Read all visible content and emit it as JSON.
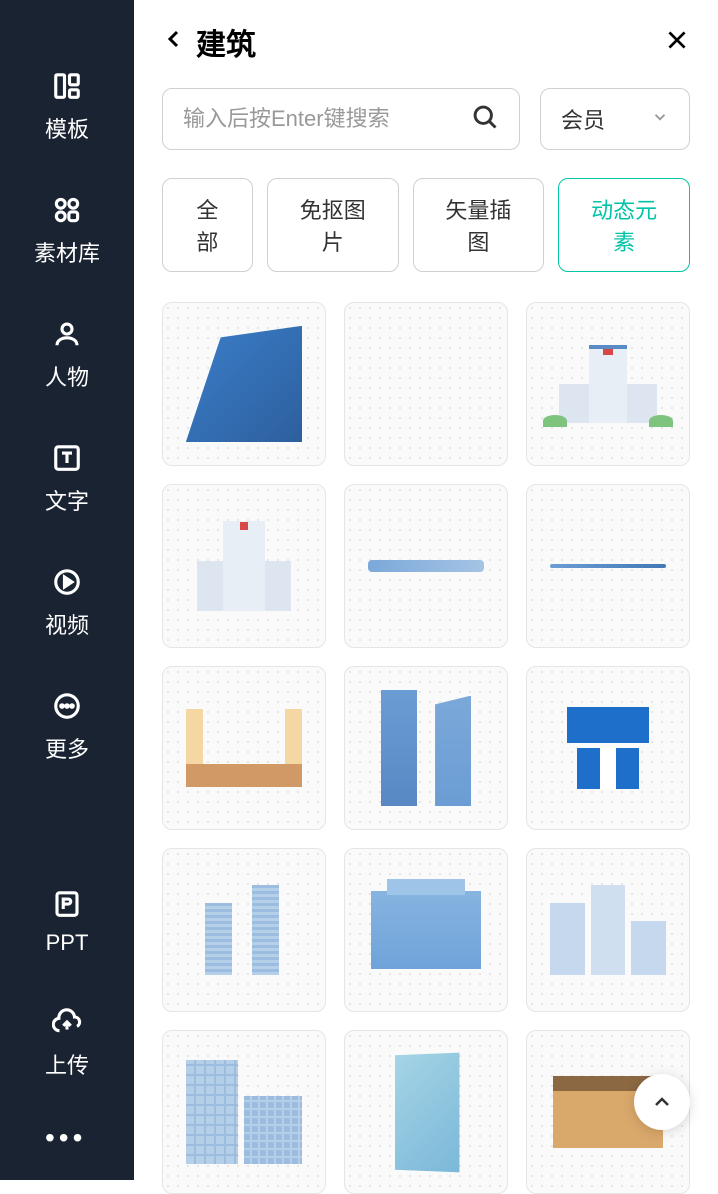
{
  "sidebar": {
    "items": [
      {
        "label": "模板",
        "icon": "template-icon"
      },
      {
        "label": "素材库",
        "icon": "assets-icon"
      },
      {
        "label": "人物",
        "icon": "person-icon"
      },
      {
        "label": "文字",
        "icon": "text-icon"
      },
      {
        "label": "视频",
        "icon": "video-icon"
      },
      {
        "label": "更多",
        "icon": "more-icon"
      }
    ],
    "bottom": [
      {
        "label": "PPT",
        "icon": "ppt-icon"
      },
      {
        "label": "上传",
        "icon": "upload-icon"
      }
    ],
    "more_label": "•••"
  },
  "header": {
    "title": "建筑"
  },
  "search": {
    "placeholder": "输入后按Enter键搜索"
  },
  "dropdown": {
    "label": "会员"
  },
  "filters": [
    {
      "label": "全部",
      "active": false
    },
    {
      "label": "免抠图片",
      "active": false
    },
    {
      "label": "矢量插图",
      "active": false
    },
    {
      "label": "动态元素",
      "active": true
    }
  ],
  "grid_items": [
    {
      "name": "building-wall-angle"
    },
    {
      "name": "building-flat-light"
    },
    {
      "name": "hospital-complex"
    },
    {
      "name": "hospital-single"
    },
    {
      "name": "horizon-strip"
    },
    {
      "name": "thin-line"
    },
    {
      "name": "frame-tan"
    },
    {
      "name": "twin-towers"
    },
    {
      "name": "gate-blue"
    },
    {
      "name": "two-slim-towers"
    },
    {
      "name": "stadium-blue"
    },
    {
      "name": "building-cluster-light"
    },
    {
      "name": "apartment-blocks"
    },
    {
      "name": "glass-tower"
    },
    {
      "name": "wood-shed"
    }
  ]
}
